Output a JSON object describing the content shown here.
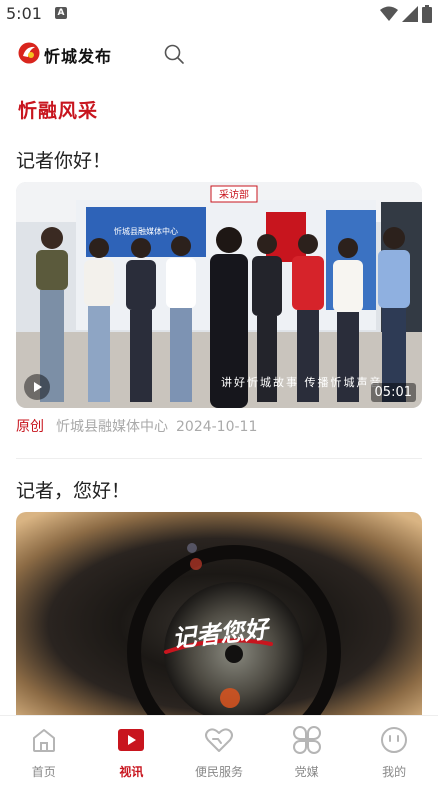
{
  "status_bar": {
    "time": "5:01",
    "notif_glyph": "A"
  },
  "header": {
    "app_name": "忻城发布"
  },
  "section": {
    "title": "忻融风采"
  },
  "feed": [
    {
      "title": "记者你好！",
      "badge": "原创",
      "source": "忻城县融媒体中心",
      "date": "2024-10-11",
      "duration": "05:01",
      "caption": "讲好忻城故事 传播忻城声音",
      "sign": "采访部",
      "banner": "忻城县融媒体中心"
    },
    {
      "title": "记者，您好！",
      "overlay": "记者您好"
    }
  ],
  "tabs": [
    {
      "label": "首页",
      "icon": "home-icon",
      "active": false
    },
    {
      "label": "视讯",
      "icon": "video-play-icon",
      "active": true
    },
    {
      "label": "便民服务",
      "icon": "heart-service-icon",
      "active": false
    },
    {
      "label": "党媒",
      "icon": "clover-grid-icon",
      "active": false
    },
    {
      "label": "我的",
      "icon": "face-icon",
      "active": false
    }
  ],
  "colors": {
    "accent": "#c8151e",
    "tab_inactive": "#888888"
  }
}
